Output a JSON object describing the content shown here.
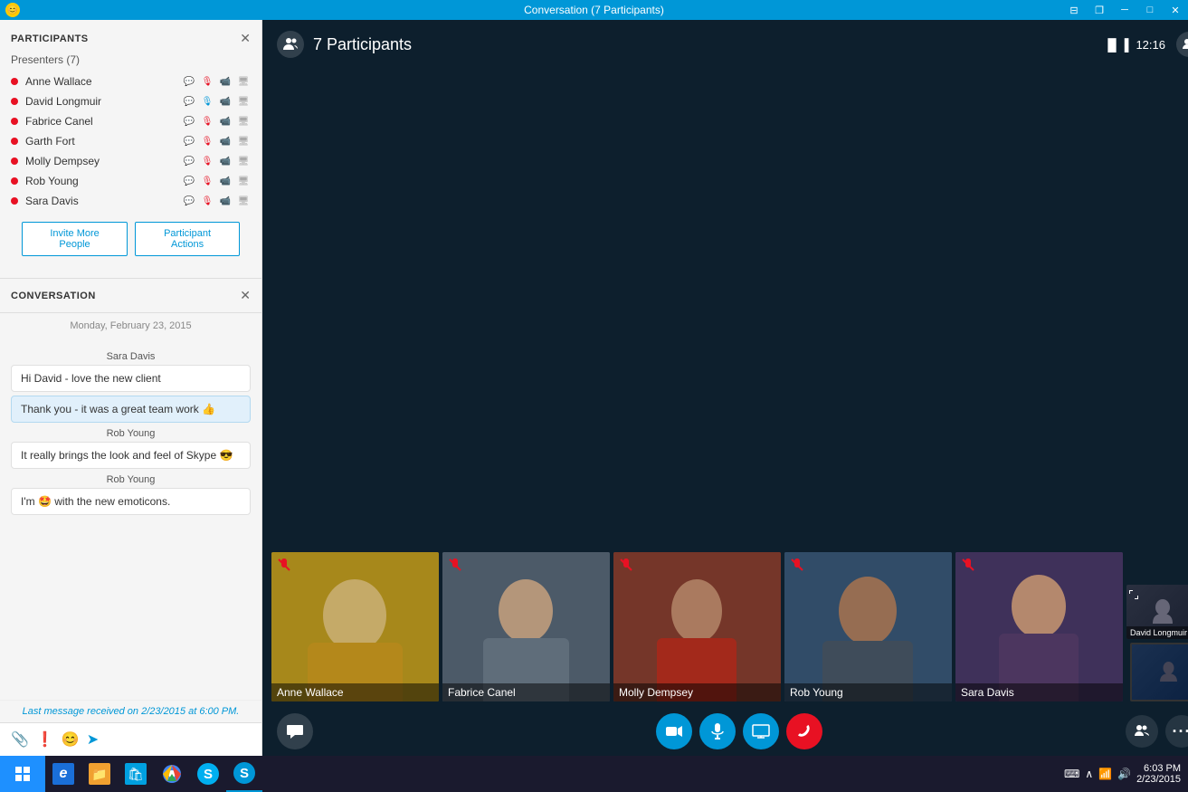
{
  "titlebar": {
    "title": "Conversation (7 Participants)",
    "emoji": "😊",
    "controls": [
      "snap",
      "restore-down",
      "minimize",
      "maximize",
      "close"
    ]
  },
  "participants": {
    "section_title": "PARTICIPANTS",
    "presenters_label": "Presenters (7)",
    "people": [
      {
        "name": "Anne Wallace",
        "status": "active"
      },
      {
        "name": "David Longmuir",
        "status": "active"
      },
      {
        "name": "Fabrice Canel",
        "status": "active"
      },
      {
        "name": "Garth Fort",
        "status": "active"
      },
      {
        "name": "Molly Dempsey",
        "status": "active"
      },
      {
        "name": "Rob Young",
        "status": "active"
      },
      {
        "name": "Sara Davis",
        "status": "active"
      }
    ],
    "invite_btn": "Invite More People",
    "actions_btn": "Participant Actions"
  },
  "conversation": {
    "section_title": "CONVERSATION",
    "date": "Monday, February 23, 2015",
    "messages": [
      {
        "sender": "Sara Davis",
        "text": "Hi David - love the new client",
        "type": "received"
      },
      {
        "sender": "",
        "text": "Thank you - it was a great team work 👍",
        "type": "sent"
      },
      {
        "sender": "Rob Young",
        "text": "It really brings the look and feel of Skype 😎",
        "type": "received"
      },
      {
        "sender": "Rob Young",
        "text": "I'm 🤩 with the new emoticons.",
        "type": "received"
      }
    ],
    "last_message": "Last message received on 2/23/2015 at 6:00 PM."
  },
  "video": {
    "participants_count": "7 Participants",
    "signal": "▐▐▐",
    "time": "12:16",
    "thumbnails": [
      {
        "name": "Anne Wallace",
        "muted": true,
        "color": "#b5a020"
      },
      {
        "name": "Fabrice Canel",
        "muted": true,
        "color": "#5a6a7a"
      },
      {
        "name": "Molly Dempsey",
        "muted": true,
        "color": "#8a4030"
      },
      {
        "name": "Rob Young",
        "muted": true,
        "color": "#3a5a7a"
      },
      {
        "name": "Sara Davis",
        "muted": true,
        "color": "#4a3a6a"
      },
      {
        "name": "David Longmuir",
        "muted": false,
        "small": true
      }
    ],
    "controls": {
      "chat": "💬",
      "video": "📷",
      "mic": "🎤",
      "screen": "🖥",
      "end": "📞",
      "participants": "👥",
      "more": "⋯"
    }
  },
  "taskbar": {
    "apps": [
      {
        "name": "Start",
        "icon": "⊞"
      },
      {
        "name": "IE",
        "icon": "e"
      },
      {
        "name": "Explorer",
        "icon": "📁"
      },
      {
        "name": "Store",
        "icon": "🛍"
      },
      {
        "name": "Chrome",
        "icon": "●"
      },
      {
        "name": "Skype",
        "icon": "S"
      },
      {
        "name": "Skype Active",
        "icon": "S"
      }
    ],
    "time": "6:03 PM",
    "date": "2/23/2015",
    "sys_icons": [
      "⌨",
      "↑",
      "📶",
      "🔊"
    ]
  }
}
